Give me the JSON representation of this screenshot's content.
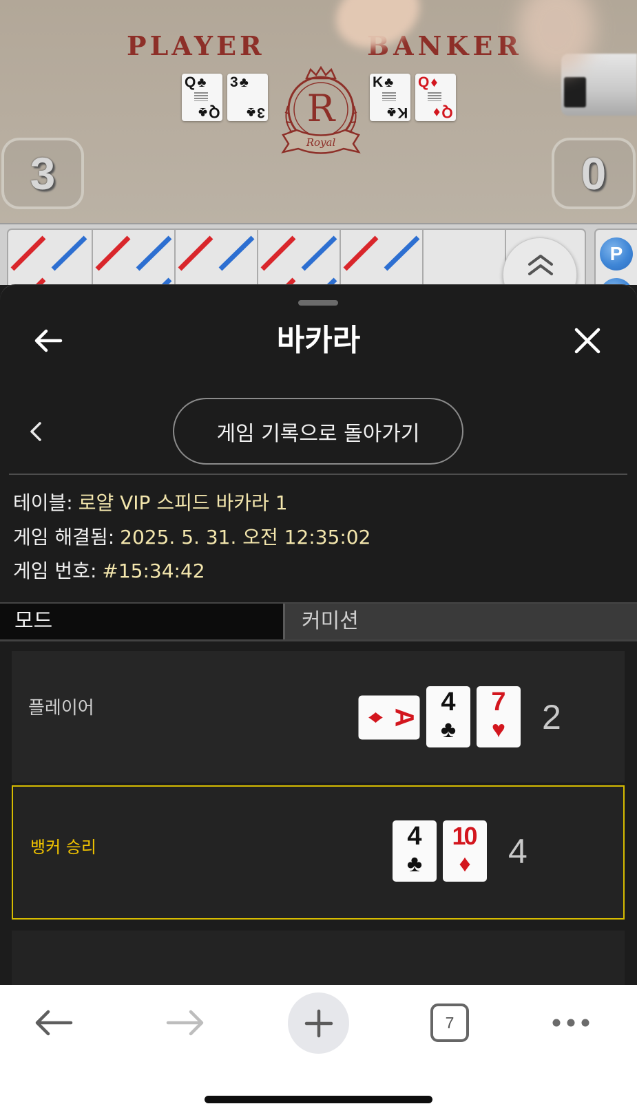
{
  "video": {
    "player_label": "PLAYER",
    "banker_label": "BANKER",
    "crest_letter": "R",
    "crest_ribbon": "Royal",
    "player_score": "3",
    "banker_score": "0",
    "player_cards": [
      {
        "rank": "Q",
        "suit": "♣",
        "color": "black"
      },
      {
        "rank": "3",
        "suit": "♣",
        "color": "black"
      }
    ],
    "banker_cards": [
      {
        "rank": "K",
        "suit": "♣",
        "color": "black"
      },
      {
        "rank": "Q",
        "suit": "♦",
        "color": "red"
      }
    ]
  },
  "road": {
    "badge": "P",
    "expand_icon": "double-chevron-up-icon",
    "rows": [
      [
        {
          "left": "red",
          "right": "blue"
        },
        {
          "left": "red",
          "right": "blue"
        },
        {
          "left": "red",
          "right": "blue"
        },
        {
          "left": "red",
          "right": "blue"
        },
        {
          "left": "red",
          "right": "blue"
        },
        {},
        {}
      ],
      [
        {
          "left": "red"
        },
        {
          "right": "blue"
        },
        {},
        {
          "left": "red",
          "right": "blue"
        },
        {},
        {},
        {}
      ]
    ]
  },
  "sheet": {
    "title": "바카라",
    "back_to_history_label": "게임 기록으로 돌아가기",
    "icons": {
      "back": "arrow-left-icon",
      "close": "close-icon",
      "history": "chevron-left-icon"
    }
  },
  "details": {
    "table_label": "테이블:",
    "table_value": "로얄 VIP 스피드 바카라 1",
    "resolved_label": "게임 해결됨:",
    "resolved_value": "2025. 5. 31. 오전 12:35:02",
    "number_label": "게임 번호:",
    "number_value": "#15:34:42"
  },
  "tabs": [
    {
      "label": "모드",
      "selected": true
    },
    {
      "label": "커미션",
      "selected": false
    }
  ],
  "player": {
    "label": "플레이어",
    "score": "2",
    "cards": [
      {
        "rank": "A",
        "suit": "♦",
        "color": "red",
        "orientation": "sideways"
      },
      {
        "rank": "4",
        "suit": "♣",
        "color": "black"
      },
      {
        "rank": "7",
        "suit": "♥",
        "color": "red"
      }
    ]
  },
  "banker": {
    "label": "뱅커 승리",
    "score": "4",
    "winner": true,
    "cards": [
      {
        "rank": "4",
        "suit": "♣",
        "color": "black"
      },
      {
        "rank": "10",
        "suit": "♦",
        "color": "red"
      }
    ]
  },
  "browser_toolbar": {
    "tab_count": "7",
    "forward_enabled": false,
    "icons": [
      "arrow-left-icon",
      "arrow-right-icon",
      "plus-icon",
      "tabs-icon",
      "more-icon"
    ]
  },
  "colors": {
    "road_red": "#d9262b",
    "road_blue": "#2d6fd1",
    "info_value": "#f3e6ad",
    "winner_accent": "#f0c300",
    "winner_border": "#d6bb00",
    "sheet_bg": "#1c1c1c",
    "table_felt": "#b6ab9c",
    "table_text": "#8d2f28",
    "card_red": "#d3161e"
  }
}
